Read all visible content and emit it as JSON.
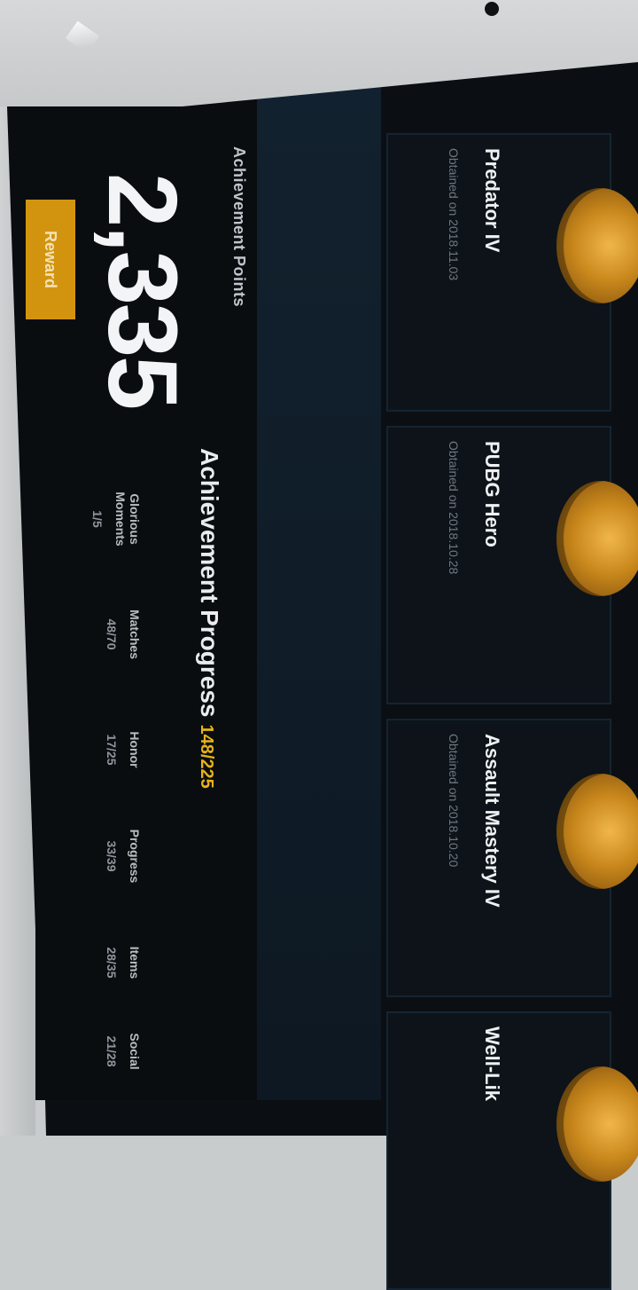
{
  "achievement_points": {
    "label": "Achievement Points",
    "value": "2,335",
    "reward_label": "Reward"
  },
  "progress": {
    "title": "Achievement Progress",
    "count": "148/225",
    "categories": [
      {
        "label": "Glorious Moments",
        "value": "1/5"
      },
      {
        "label": "Matches",
        "value": "48/70"
      },
      {
        "label": "Honor",
        "value": "17/25"
      },
      {
        "label": "Progress",
        "value": "33/39"
      },
      {
        "label": "Items",
        "value": "28/35"
      },
      {
        "label": "Social",
        "value": "21/28"
      }
    ]
  },
  "recent": [
    {
      "title": "Predator IV",
      "date": "Obtained on 2018.11.03"
    },
    {
      "title": "PUBG Hero",
      "date": "Obtained on 2018.10.28"
    },
    {
      "title": "Assault Mastery IV",
      "date": "Obtained on 2018.10.20"
    },
    {
      "title": "Well-Lik",
      "date": ""
    }
  ],
  "colors": {
    "accent_gold": "#d2940f",
    "highlight_yellow": "#e6b319",
    "background": "#0a0d10"
  }
}
